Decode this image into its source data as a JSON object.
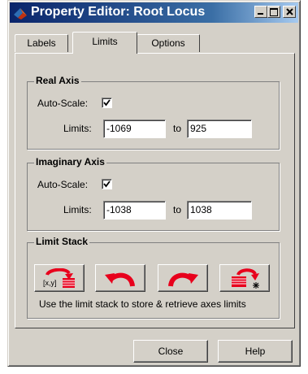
{
  "window": {
    "title": "Property Editor: Root Locus",
    "icon": "matlab-logo-icon"
  },
  "tabs": [
    {
      "label": "Labels",
      "active": false
    },
    {
      "label": "Limits",
      "active": true
    },
    {
      "label": "Options",
      "active": false
    }
  ],
  "real_axis": {
    "title": "Real Axis",
    "auto_scale_label": "Auto-Scale:",
    "auto_scale_checked": true,
    "limits_label": "Limits:",
    "min": "-1069",
    "to_label": "to",
    "max": "925"
  },
  "imaginary_axis": {
    "title": "Imaginary Axis",
    "auto_scale_label": "Auto-Scale:",
    "auto_scale_checked": true,
    "limits_label": "Limits:",
    "min": "-1038",
    "to_label": "to",
    "max": "1038"
  },
  "limit_stack": {
    "title": "Limit Stack",
    "buttons": [
      {
        "icon": "store-limits-icon",
        "text": "[x,y]"
      },
      {
        "icon": "undo-arrow-icon"
      },
      {
        "icon": "redo-arrow-icon"
      },
      {
        "icon": "clear-stack-icon"
      }
    ],
    "help_text": "Use the limit stack to store & retrieve axes limits"
  },
  "footer": {
    "close_label": "Close",
    "help_label": "Help"
  },
  "colors": {
    "title_start": "#0a246a",
    "title_end": "#a6caf0",
    "face": "#d4d0c8",
    "icon_red": "#e8001c"
  }
}
